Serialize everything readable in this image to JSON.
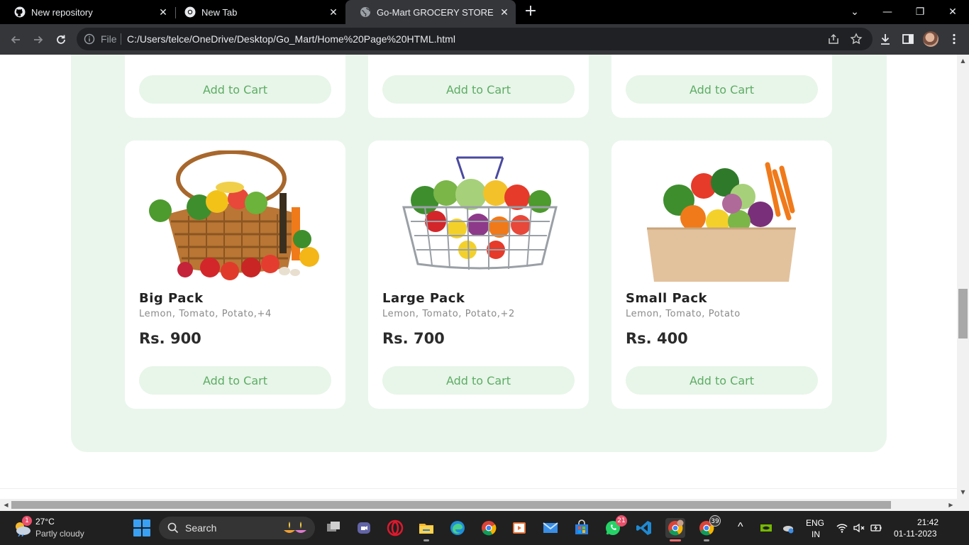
{
  "browser": {
    "tabs": [
      {
        "title": "New repository",
        "icon": "github-icon",
        "active": false
      },
      {
        "title": "New Tab",
        "icon": "chrome-icon",
        "active": false
      },
      {
        "title": "Go-Mart GROCERY STORE",
        "icon": "globe-icon",
        "active": true
      }
    ],
    "new_tab_symbol": "+",
    "window_controls": {
      "minimize": "—",
      "restore": "❐",
      "close": "✕",
      "tab_search": "⌄"
    },
    "address_bar": {
      "scheme_label": "File",
      "url": "C:/Users/telce/OneDrive/Desktop/Go_Mart/Home%20Page%20HTML.html"
    }
  },
  "page": {
    "top_row_buttons": [
      "Add to Cart",
      "Add to Cart",
      "Add to Cart"
    ],
    "products": [
      {
        "name": "Big Pack",
        "description": "Lemon, Tomato, Potato,+4",
        "price": "Rs. 900",
        "button": "Add to Cart",
        "image": "basket-of-vegetables"
      },
      {
        "name": "Large Pack",
        "description": "Lemon, Tomato, Potato,+2",
        "price": "Rs. 700",
        "button": "Add to Cart",
        "image": "wire-basket-of-vegetables"
      },
      {
        "name": "Small Pack",
        "description": "Lemon, Tomato, Potato",
        "price": "Rs. 400",
        "button": "Add to Cart",
        "image": "box-of-vegetables"
      }
    ],
    "colors": {
      "panel": "#eaf6ec",
      "button_bg": "#e8f5e9",
      "button_text": "#5cad63"
    }
  },
  "taskbar": {
    "weather": {
      "temp": "27°C",
      "desc": "Partly cloudy",
      "badge": "1"
    },
    "search_placeholder": "Search",
    "apps": [
      {
        "name": "task-view-icon"
      },
      {
        "name": "teams-icon"
      },
      {
        "name": "opera-icon"
      },
      {
        "name": "file-explorer-icon"
      },
      {
        "name": "edge-icon"
      },
      {
        "name": "chrome-icon"
      },
      {
        "name": "media-player-icon"
      },
      {
        "name": "mail-icon"
      },
      {
        "name": "ms-store-icon"
      },
      {
        "name": "whatsapp-icon",
        "badge": "21"
      },
      {
        "name": "vscode-icon"
      },
      {
        "name": "chrome-profile-icon"
      },
      {
        "name": "chrome-profile-2-icon",
        "badge": "39"
      }
    ],
    "tray": {
      "lang_top": "ENG",
      "lang_bottom": "IN",
      "time": "21:42",
      "date": "01-11-2023",
      "caret": "^"
    }
  }
}
